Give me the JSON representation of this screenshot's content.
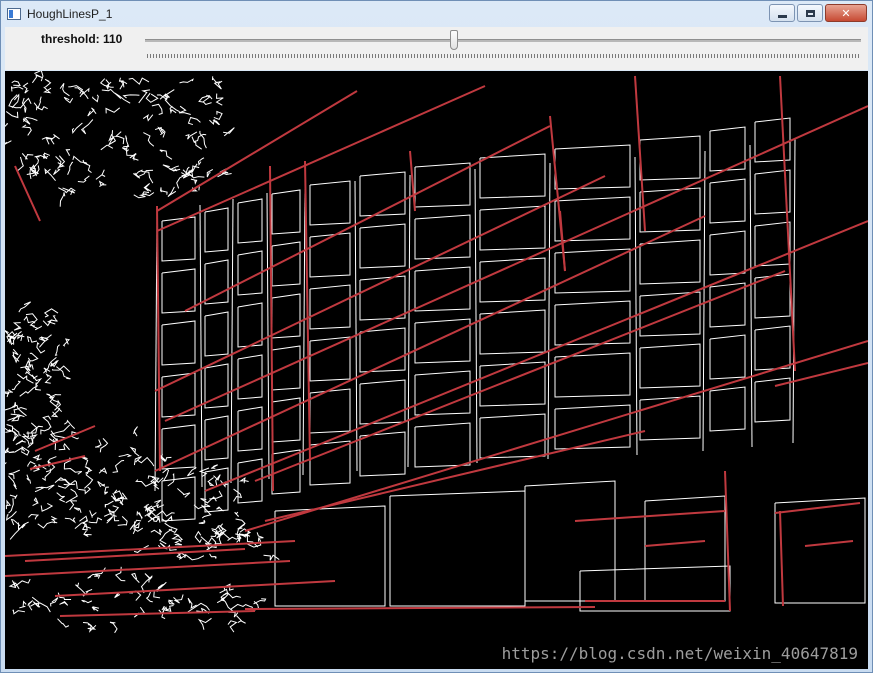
{
  "window": {
    "title": "HoughLinesP_1",
    "controls": {
      "minimize_icon": "minimize-icon",
      "maximize_icon": "maximize-icon",
      "close_glyph": "✕"
    }
  },
  "toolbar": {
    "trackbar_label": "threshold: 110",
    "trackbar_value": 110,
    "trackbar_max": 255
  },
  "canvas": {
    "background_color": "#000000",
    "edge_color": "#ffffff",
    "line_color": "#c0393f",
    "watermark": "https://blog.csdn.net/weixin_40647819"
  }
}
